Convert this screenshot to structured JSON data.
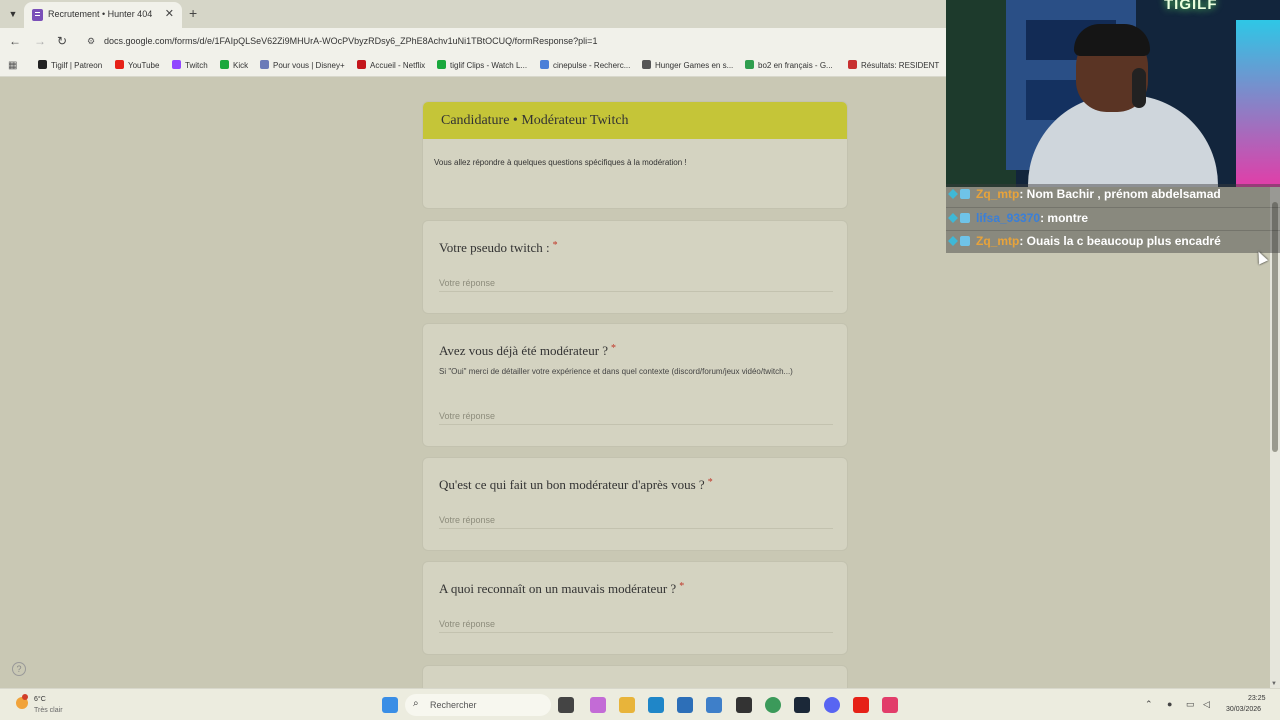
{
  "browser": {
    "tab_title": "Recrutement • Hunter 404",
    "url": "docs.google.com/forms/d/e/1FAIpQLSeV62Zi9MHUrA-WOcPVbyzRDsy6_ZPhE8Achv1uNi1TBtOCUQ/formResponse?pli=1",
    "bookmarks": [
      {
        "label": "Tigilf | Patreon",
        "color": "#222222"
      },
      {
        "label": "YouTube",
        "color": "#e62117"
      },
      {
        "label": "Twitch",
        "color": "#9146ff"
      },
      {
        "label": "Kick",
        "color": "#1aa83d"
      },
      {
        "label": "Pour vous | Disney+",
        "color": "#6b7bb8"
      },
      {
        "label": "Accueil - Netflix",
        "color": "#c4161c"
      },
      {
        "label": "tiglif Clips - Watch L...",
        "color": "#1aa83d"
      },
      {
        "label": "cinepulse - Recherc...",
        "color": "#4a7fd8"
      },
      {
        "label": "Hunger Games en s...",
        "color": "#555555"
      },
      {
        "label": "bo2 en français - G...",
        "color": "#2f9e4e"
      },
      {
        "label": "Résultats: RESIDENT",
        "color": "#c83030"
      }
    ]
  },
  "form": {
    "title": "Candidature • Modérateur Twitch",
    "description": "Vous allez répondre à quelques questions spécifiques à la modération !",
    "answer_placeholder": "Votre réponse",
    "required_mark": "*",
    "questions": [
      {
        "title": "Votre pseudo twitch :",
        "help": ""
      },
      {
        "title": "Avez vous déjà été modérateur ?",
        "help": "Si \"Oui\" merci de détailler votre expérience et dans quel contexte (discord/forum/jeux vidéo/twitch...)"
      },
      {
        "title": "Qu'est ce qui fait un bon modérateur d'après vous ?",
        "help": ""
      },
      {
        "title": "A quoi reconnaît on un mauvais modérateur ?",
        "help": ""
      }
    ]
  },
  "stream": {
    "neon_sign": "TIGILF",
    "chat": [
      {
        "user": "Zq_mtp",
        "user_color": "#e8a33a",
        "message": ": Nom Bachir , prénom abdelsamad"
      },
      {
        "user": "lifsa_93370",
        "user_color": "#3a7fd8",
        "message": ": montre"
      },
      {
        "user": "Zq_mtp",
        "user_color": "#e8a33a",
        "message": ": Ouais la c beaucoup plus encadré"
      }
    ]
  },
  "taskbar": {
    "weather_temp": "6°C",
    "weather_desc": "Très clair",
    "search_placeholder": "Rechercher",
    "time": "23:25",
    "date": "30/03/2026"
  }
}
